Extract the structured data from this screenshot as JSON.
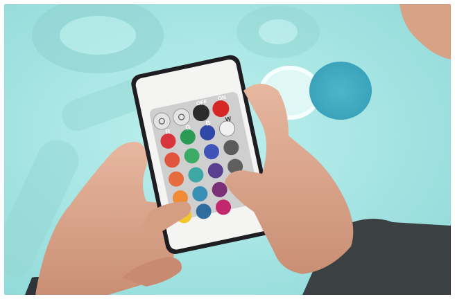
{
  "scene": {
    "subject": "hands-holding-rgb-led-remote",
    "colors": {
      "background": "#a8e6e4",
      "remote_body": "#f4f4f2",
      "remote_frame": "#1e1e22",
      "skin": "#d9a58a",
      "sleeve": "#3b4142"
    }
  },
  "remote": {
    "buttons": {
      "off_label": "OFF",
      "on_label": "ON",
      "r_label": "R",
      "g_label": "G",
      "b_label": "B",
      "w_label": "W"
    }
  }
}
